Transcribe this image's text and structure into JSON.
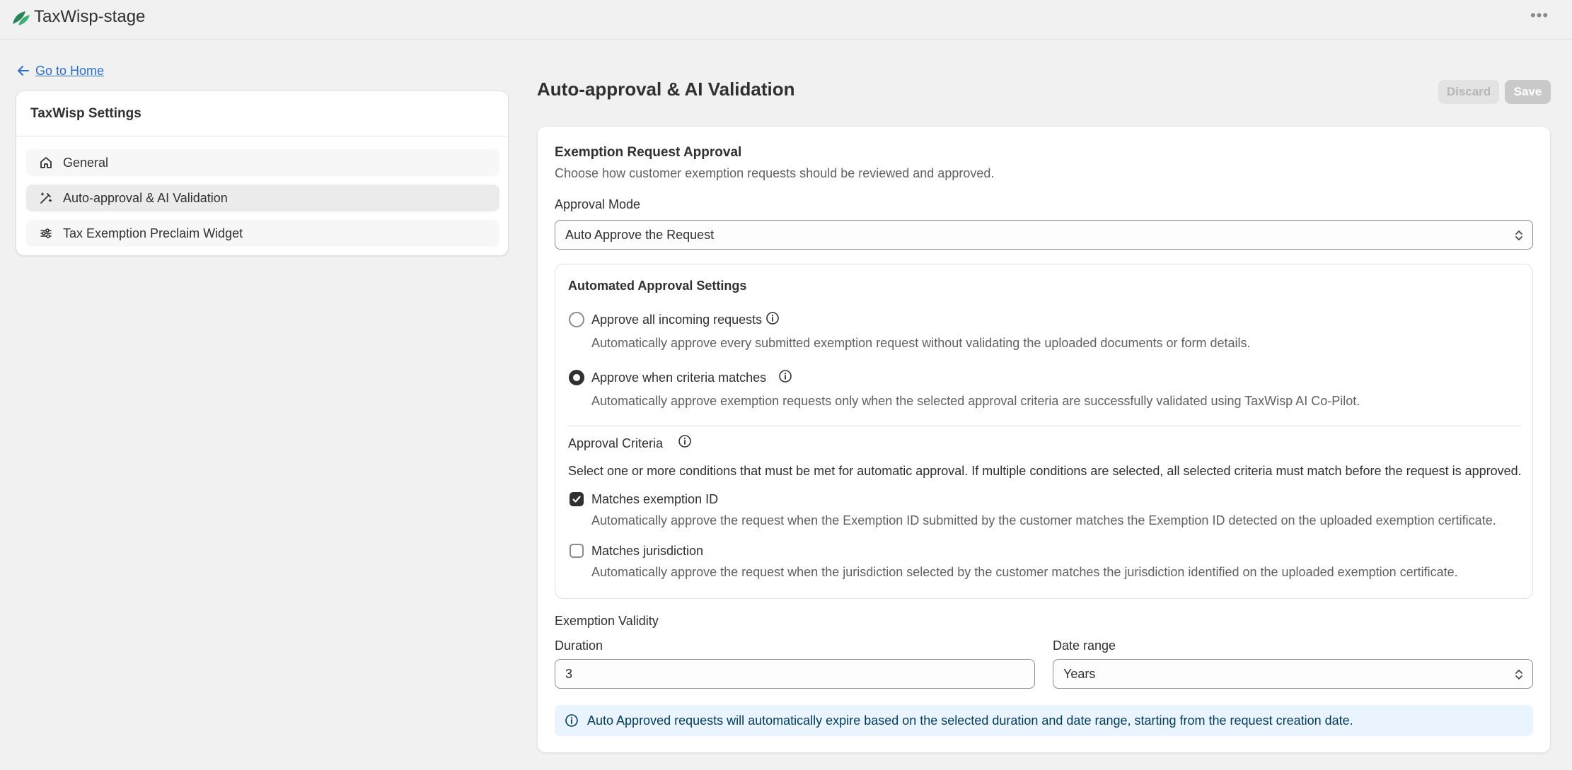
{
  "app": {
    "title": "TaxWisp-stage",
    "more_icon": "more-horizontal-icon"
  },
  "colors": {
    "link": "#2c6ecb",
    "primary_dark": "#303030",
    "banner_bg": "#eaf4ff",
    "logo_green": "#29845a"
  },
  "left": {
    "back_link": "Go to Home",
    "card_title": "TaxWisp Settings",
    "nav": [
      {
        "label": "General",
        "icon": "home-icon"
      },
      {
        "label": "Auto-approval & AI Validation",
        "icon": "magic-wand-icon",
        "active": true
      },
      {
        "label": "Tax Exemption Preclaim Widget",
        "icon": "sliders-icon"
      }
    ]
  },
  "main": {
    "page_title": "Auto-approval & AI Validation",
    "discard_label": "Discard",
    "save_label": "Save",
    "section_title": "Exemption Request Approval",
    "section_desc": "Choose how customer exemption requests should be reviewed and approved.",
    "approval_mode_label": "Approval Mode",
    "approval_mode_value": "Auto Approve the Request",
    "automated": {
      "title": "Automated Approval Settings",
      "options": [
        {
          "label": "Approve all incoming requests",
          "desc": "Automatically approve every submitted exemption request without validating the uploaded documents or form details.",
          "checked": false
        },
        {
          "label": "Approve when criteria matches",
          "desc": "Automatically approve exemption requests only when the selected approval criteria are successfully validated using TaxWisp AI Co-Pilot.",
          "checked": true
        }
      ],
      "criteria_title": "Approval Criteria",
      "criteria_desc": "Select one or more conditions that must be met for automatic approval. If multiple conditions are selected, all selected criteria must match before the request is approved.",
      "criteria": [
        {
          "label": "Matches exemption ID",
          "desc": "Automatically approve the request when the Exemption ID submitted by the customer matches the Exemption ID detected on the uploaded exemption certificate.",
          "checked": true
        },
        {
          "label": "Matches jurisdiction",
          "desc": "Automatically approve the request when the jurisdiction selected by the customer matches the jurisdiction identified on the uploaded exemption certificate.",
          "checked": false
        }
      ]
    },
    "validity": {
      "title": "Exemption Validity",
      "duration_label": "Duration",
      "duration_value": "3",
      "range_label": "Date range",
      "range_value": "Years"
    },
    "banner_text": "Auto Approved requests will automatically expire based on the selected duration and date range, starting from the request creation date."
  }
}
